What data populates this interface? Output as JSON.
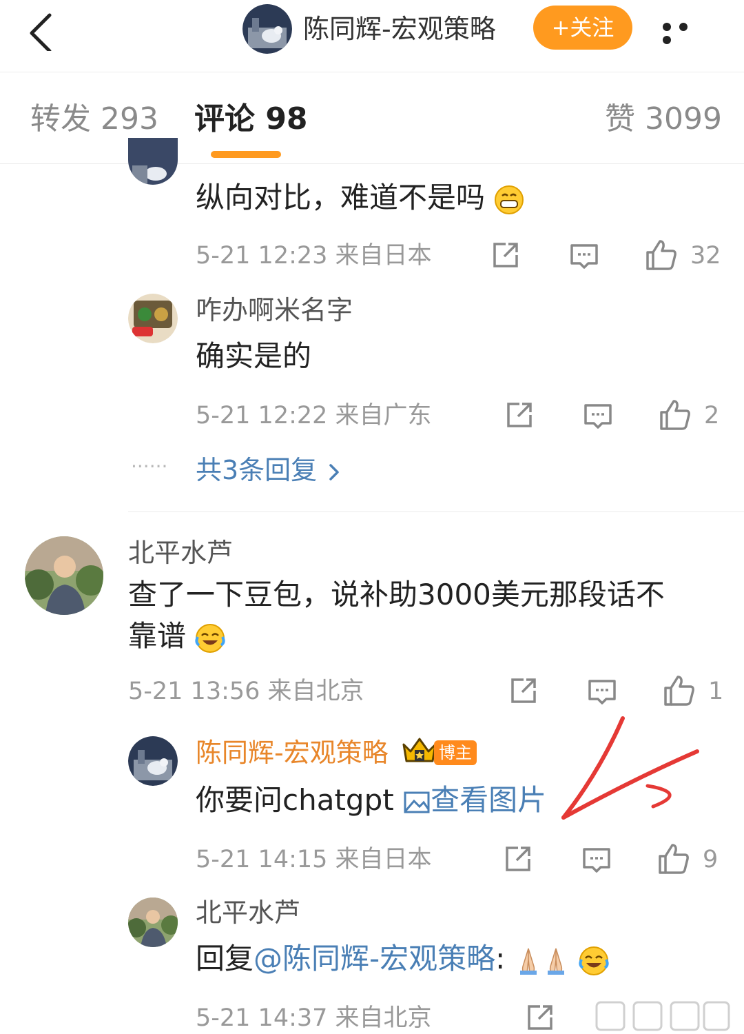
{
  "header": {
    "account_name": "陈同辉-宏观策略",
    "follow_label": "+关注"
  },
  "tabs": {
    "repost": "转发 293",
    "comments": "评论 98",
    "likes": "赞 3099"
  },
  "thread1": {
    "text": "纵向对比，难道不是吗",
    "meta": "5-21 12:23  来自日本",
    "like_count": "32"
  },
  "reply1": {
    "name": "咋办啊米名字",
    "text": "确实是的",
    "meta": "5-21 12:22  来自广东",
    "like_count": "2"
  },
  "more_replies": {
    "dots": "······",
    "label": "共3条回复"
  },
  "comment2": {
    "name": "北平水芦",
    "text_line1": "查了一下豆包，说补助3000美元那段话不",
    "text_line2": "靠谱",
    "meta": "5-21 13:56  来自北京",
    "like_count": "1"
  },
  "reply2": {
    "name": "陈同辉-宏观策略",
    "badge": "博主",
    "text": "你要问chatgpt ",
    "image_link": "查看图片",
    "meta": "5-21 14:15  来自日本",
    "like_count": "9"
  },
  "reply3": {
    "name": "北平水芦",
    "prefix": "回复",
    "mention": "@陈同辉-宏观策略",
    "suffix": ":",
    "meta": "5-21 14:37  来自北京"
  },
  "colors": {
    "accent": "#ff9a1f",
    "link": "#4a7fb5",
    "annotation": "#e53935"
  }
}
